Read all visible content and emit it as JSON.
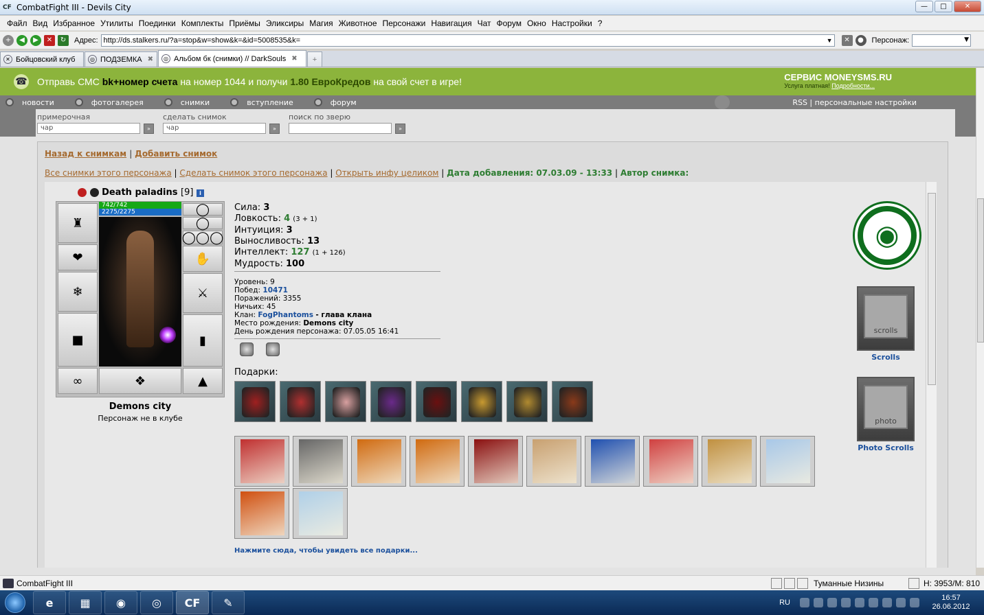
{
  "window": {
    "title": "CombatFight III - Devils City",
    "app_icon": "CF"
  },
  "menu": [
    "Файл",
    "Вид",
    "Избранное",
    "Утилиты",
    "Поединки",
    "Комплекты",
    "Приёмы",
    "Эликсиры",
    "Магия",
    "Животное",
    "Персонажи",
    "Навигация",
    "Чат",
    "Форум",
    "Окно",
    "Настройки",
    "?"
  ],
  "address_bar": {
    "label": "Адрес:",
    "url": "http://ds.stalkers.ru/?a=stop&w=show&k=&id=5008535&k=",
    "persona_label": "Персонаж:",
    "persona_value": ""
  },
  "tabs": [
    {
      "label": "Бойцовский клуб",
      "active": false
    },
    {
      "label": "ПОДЗЕМКА",
      "active": false
    },
    {
      "label": "Альбом бк (снимки) // DarkSouls",
      "active": true
    }
  ],
  "banner": {
    "prefix": "Отправь СМС",
    "code": "bk+номер счета",
    "middle": "на номер 1044 и получи",
    "amount": "1.80 ЕвроКредов",
    "suffix": "на свой счет в игре!",
    "service_title": "СЕРВИС MONEYSMS.RU",
    "service_sub": "Услуга платная!",
    "service_link": "Подробности..."
  },
  "topnav": {
    "items": [
      "новости",
      "фотогалерея",
      "снимки",
      "вступление",
      "форум"
    ],
    "right": "RSS | персональные настройки"
  },
  "search": [
    {
      "label": "примерочная",
      "value": "чар"
    },
    {
      "label": "сделать снимок",
      "value": "чар"
    },
    {
      "label": "поиск по зверю",
      "value": ""
    }
  ],
  "links_top": {
    "back": "Назад к снимкам",
    "add": "Добавить снимок"
  },
  "links_row": {
    "all_shots": "Все снимки этого персонажа",
    "make_shot": "Сделать снимок этого персонажа",
    "open_info": "Открыть инфу целиком",
    "date_added": "Дата добавления: 07.03.09 - 13:33",
    "author": "Автор снимка:"
  },
  "character": {
    "name": "Death paladins",
    "level": "[9]",
    "hp": "742/742",
    "mp": "2275/2275",
    "city": "Demons city",
    "club": "Персонаж не в клубе"
  },
  "stats": [
    {
      "label": "Сила:",
      "value": "3",
      "extra": "",
      "green": false
    },
    {
      "label": "Ловкость:",
      "value": "4",
      "extra": "(3 + 1)",
      "green": true
    },
    {
      "label": "Интуиция:",
      "value": "3",
      "extra": "",
      "green": false
    },
    {
      "label": "Выносливость:",
      "value": "13",
      "extra": "",
      "green": false
    },
    {
      "label": "Интеллект:",
      "value": "127",
      "extra": "(1 + 126)",
      "green": true
    },
    {
      "label": "Мудрость:",
      "value": "100",
      "extra": "",
      "green": false
    }
  ],
  "info": {
    "level": "Уровень: 9",
    "wins_label": "Побед:",
    "wins": "10471",
    "losses": "Поражений: 3355",
    "draws": "Ничьих: 45",
    "clan_label": "Клан:",
    "clan": "FogPhantoms",
    "clan_role": "- глава клана",
    "birthplace_label": "Место рождения:",
    "birthplace": "Demons city",
    "birthday": "День рождения персонажа: 07.05.05 16:41"
  },
  "gifts_label": "Подарки:",
  "gifts_row1": [
    {
      "name": "gift-book",
      "color": "#a02020"
    },
    {
      "name": "gift-santa",
      "color": "#b03030"
    },
    {
      "name": "gift-pig",
      "color": "#d8a0a0"
    },
    {
      "name": "gift-chocolate",
      "color": "#6a2a8a"
    },
    {
      "name": "gift-statue",
      "color": "#6a1010"
    },
    {
      "name": "gift-medal",
      "color": "#c89a30"
    },
    {
      "name": "gift-necklace",
      "color": "#b08a30"
    },
    {
      "name": "gift-mug",
      "color": "#8a3a1a"
    }
  ],
  "cards_row1": [
    {
      "name": "card-february",
      "color": "#c03030"
    },
    {
      "name": "card-grey",
      "color": "#666"
    },
    {
      "name": "card-fire-1",
      "color": "#d06a10"
    },
    {
      "name": "card-fire-2",
      "color": "#d06a10"
    },
    {
      "name": "card-may9",
      "color": "#8a1010"
    },
    {
      "name": "card-white",
      "color": "#c8a070"
    },
    {
      "name": "card-blue-tree",
      "color": "#2050b0"
    },
    {
      "name": "card-2007",
      "color": "#d04040"
    },
    {
      "name": "card-balloons",
      "color": "#c09040"
    },
    {
      "name": "card-2008",
      "color": "#a8c8e8"
    }
  ],
  "cards_row2": [
    {
      "name": "card-2008-fire",
      "color": "#d05010"
    },
    {
      "name": "card-2008-snow",
      "color": "#b0d0e8"
    }
  ],
  "see_all_gifts": "Нажмите сюда, чтобы увидеть все подарки...",
  "right_panel": {
    "scrolls_label": "Scrolls",
    "scrolls_text": "scrolls",
    "photo_label": "Photo Scrolls",
    "photo_text": "photo"
  },
  "statusbar": {
    "app": "CombatFight III",
    "location": "Туманные Низины",
    "hm": "H: 3953/M: 810"
  },
  "taskbar": {
    "lang": "RU",
    "time": "16:57",
    "date": "26.06.2012"
  }
}
